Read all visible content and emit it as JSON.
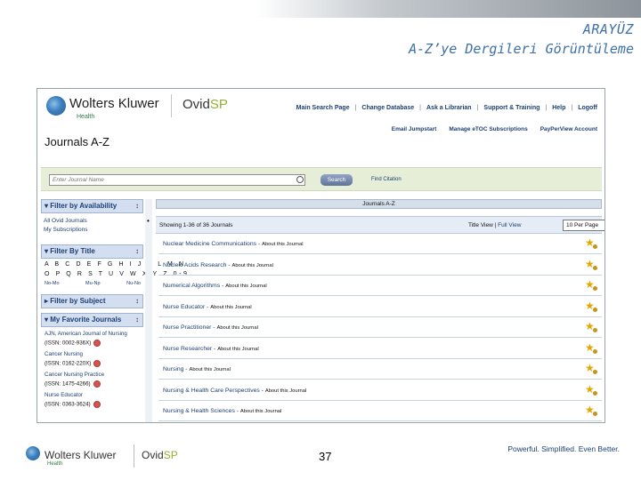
{
  "slide": {
    "title_line1": "ARAYÜZ",
    "title_line2": "A-Z’ye Dergileri Görüntüleme",
    "page_number": "37",
    "tagline": "Powerful. Simplified. Even Better."
  },
  "brand": {
    "wk_name": "Wolters Kluwer",
    "wk_sub": "Health",
    "ovid_prefix": "Ovid",
    "ovid_suffix": "SP",
    "accent_green": "#8fb130",
    "link_blue": "#1d3f73"
  },
  "topnav": {
    "main_search": "Main Search Page",
    "change_db": "Change Database",
    "ask_librarian": "Ask a Librarian",
    "support": "Support & Training",
    "help": "Help",
    "logoff": "Logoff"
  },
  "subnav": {
    "email_jumpstart": "Email Jumpstart",
    "manage_etoc": "Manage eTOC Subscriptions",
    "payperview": "PayPerView Account"
  },
  "page": {
    "title": "Journals A-Z"
  },
  "search": {
    "placeholder": "Enter Journal Name",
    "button": "Search",
    "find_citation": "Find Citation"
  },
  "filters": {
    "availability": {
      "title": "Filter by Availability",
      "items": [
        "All Ovid Journals",
        "My Subscriptions"
      ]
    },
    "title_filter": {
      "title": "Filter By Title",
      "row1": "A B C D E F G H I J K L M N",
      "row2": "O P Q R S T U V W X Y Z 0-9",
      "cn": [
        "No-Mo",
        "Mu-Np",
        "Nu-No"
      ]
    },
    "subject": {
      "title": "Filter by Subject"
    },
    "favorites": {
      "title": "My Favorite Journals",
      "items": [
        {
          "name": "AJN, American Journal of Nursing",
          "issn": "(ISSN: 0002-936X)"
        },
        {
          "name": "Cancer Nursing",
          "issn": "(ISSN: 0162-220X)"
        },
        {
          "name": "Cancer Nursing Practice",
          "issn": "(ISSN: 1475-4266)"
        },
        {
          "name": "Nurse Educator",
          "issn": "(ISSN: 0363-3624)"
        }
      ]
    }
  },
  "main": {
    "header": "Journals A-Z",
    "showing": "Showing 1-36 of 36 Journals",
    "title_view": "Title View",
    "full_view": "Full View",
    "per_page": "10 Per Page",
    "about_label": "About this Journal",
    "journals": [
      "Nuclear Medicine Communications",
      "Nucleic Acids Research",
      "Numerical Algorithms",
      "Nurse Educator",
      "Nurse Practitioner",
      "Nurse Researcher",
      "Nursing",
      "Nursing & Health Care Perspectives",
      "Nursing & Health Sciences"
    ]
  }
}
